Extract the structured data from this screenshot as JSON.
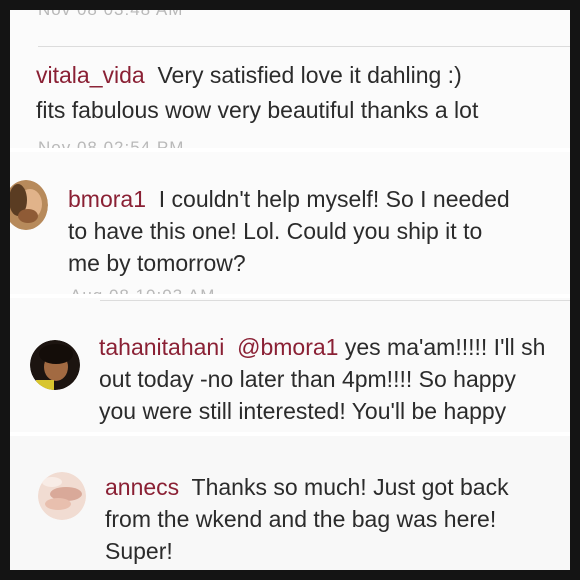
{
  "comments": [
    {
      "username": "vitala_vida",
      "text_line1": "Very satisfied love it dahling :)",
      "text_line2": "fits fabulous wow very beautiful thanks a lot"
    },
    {
      "username": "bmora1",
      "text_line1": "I couldn't help myself! So I needed",
      "text_line2": "to have this one! Lol. Could you ship it to",
      "text_line3": "me by tomorrow?"
    },
    {
      "username": "tahanitahani",
      "mention": "@bmora1",
      "text_line1": "yes ma'am!!!!! I'll sh",
      "text_line2": "out today -no later than 4pm!!!! So happy",
      "text_line3": "you were still interested! You'll be happy"
    },
    {
      "username": "annecs",
      "text_line1": "Thanks so much! Just got back",
      "text_line2": "from the wkend and the bag was here!",
      "text_line3": "Super!"
    }
  ],
  "colors": {
    "username": "#8a2034",
    "body_text": "#2b2b2b",
    "frame": "#141414"
  },
  "icons": {
    "avatar_bmora1": "avatar-icon",
    "avatar_tahanitahani": "avatar-icon",
    "avatar_annecs": "avatar-icon"
  }
}
